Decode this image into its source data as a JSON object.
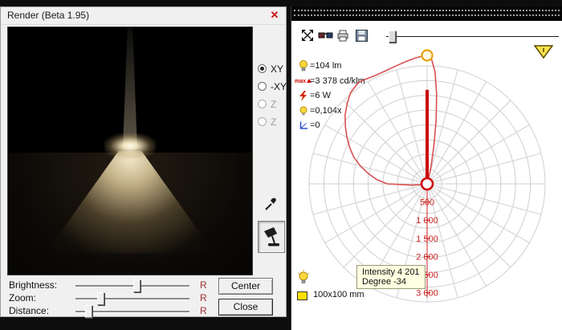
{
  "colors": {
    "accent_red": "#cc0000",
    "curve_red": "#d85050",
    "grid_gray": "#cfcfcf",
    "tooltip_bg": "#ffffe1",
    "bulb_yellow": "#ffd83d"
  },
  "render_window": {
    "title": "Render (Beta 1.95)",
    "close_glyph": "✕",
    "view_options": [
      {
        "label": "XY",
        "selected": true,
        "enabled": true
      },
      {
        "label": "-XY",
        "selected": false,
        "enabled": true
      },
      {
        "label": "Z",
        "selected": false,
        "enabled": false
      },
      {
        "label": "Z",
        "selected": false,
        "enabled": false
      }
    ],
    "tools": [
      "eyedropper",
      "luminaire"
    ],
    "sliders": [
      {
        "label": "Brightness:",
        "reset_label": "R",
        "value_pct": 54
      },
      {
        "label": "Zoom:",
        "reset_label": "R",
        "value_pct": 20
      },
      {
        "label": "Distance:",
        "reset_label": "R",
        "value_pct": 9
      }
    ],
    "center_button": "Center",
    "close_button": "Close"
  },
  "diagram_window": {
    "toolbar_icons": [
      "fit-view",
      "3d-glasses",
      "print",
      "save"
    ],
    "stats": [
      {
        "icon": "bulb-icon",
        "value": "=104 lm"
      },
      {
        "icon": "max-intensity-icon",
        "prefix": "max",
        "value": "=3 378 cd/klm"
      },
      {
        "icon": "power-icon",
        "value": "=6 W"
      },
      {
        "icon": "bulb-scale-icon",
        "value": "=0,104x"
      },
      {
        "icon": "angle-icon",
        "value": "=0"
      }
    ],
    "tooltip": {
      "intensity": "Intensity 4 201",
      "degree": "Degree -34"
    },
    "dimension_label": "100x100 mm"
  },
  "chart_data": {
    "type": "line",
    "polar": true,
    "title": "",
    "units": "cd/klm",
    "max_value": 3378,
    "max_angle_deg": -34,
    "grid": {
      "rings": 8,
      "spoke_step_deg": 15
    },
    "scale_ticks": [
      500,
      1000,
      1500,
      2000,
      2500,
      3000
    ],
    "scale_tick_labels": [
      "500",
      "1 000",
      "1 500",
      "2 000",
      "2 500",
      "3 000"
    ],
    "bar_value": 2590,
    "marker_value": 3540,
    "curve_points": [
      [
        -98,
        50
      ],
      [
        -95,
        400
      ],
      [
        -90,
        1100
      ],
      [
        -85,
        1400
      ],
      [
        -80,
        1650
      ],
      [
        -75,
        1900
      ],
      [
        -70,
        2150
      ],
      [
        -65,
        2350
      ],
      [
        -60,
        2550
      ],
      [
        -55,
        2750
      ],
      [
        -50,
        2950
      ],
      [
        -45,
        3120
      ],
      [
        -40,
        3280
      ],
      [
        -34,
        3378
      ],
      [
        -30,
        3340
      ],
      [
        -25,
        3310
      ],
      [
        -20,
        3320
      ],
      [
        -15,
        3360
      ],
      [
        -10,
        3420
      ],
      [
        -5,
        3490
      ],
      [
        0,
        3550
      ],
      [
        2,
        3450
      ],
      [
        4,
        3100
      ],
      [
        6,
        2500
      ],
      [
        8,
        1800
      ],
      [
        10,
        1100
      ],
      [
        12,
        600
      ],
      [
        14,
        300
      ],
      [
        16,
        120
      ],
      [
        18,
        40
      ]
    ]
  }
}
